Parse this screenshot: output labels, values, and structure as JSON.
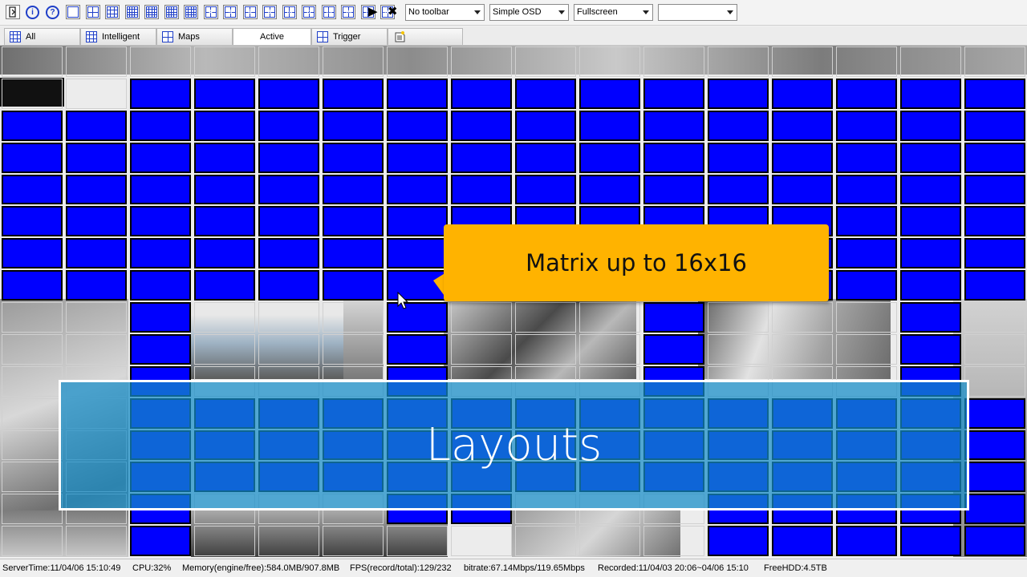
{
  "toolbar": {
    "layout_buttons": [
      "1",
      "4",
      "6",
      "9",
      "10",
      "13",
      "16",
      "4",
      "5",
      "8",
      "8",
      "10",
      "12",
      "13",
      "16",
      "16",
      "3x3"
    ],
    "osd_toolbar": "No toolbar",
    "osd_mode": "Simple OSD",
    "screen_mode": "Fullscreen",
    "extra_select": ""
  },
  "tabs": [
    {
      "label": "All"
    },
    {
      "label": "Intelligent"
    },
    {
      "label": "Maps"
    },
    {
      "label": "Active"
    },
    {
      "label": "Trigger"
    },
    {
      "label": ""
    }
  ],
  "callout": {
    "text": "Matrix up to 16x16"
  },
  "banner": {
    "text": "Layouts"
  },
  "status": {
    "server_time": "ServerTime:11/04/06 15:10:49",
    "cpu": "CPU:32%",
    "memory": "Memory(engine/free):584.0MB/907.8MB",
    "fps": "FPS(record/total):129/232",
    "bitrate": "bitrate:67.14Mbps/119.65Mbps",
    "recorded": "Recorded:11/04/03 20:06~04/06 15:10",
    "free_hdd": "FreeHDD:4.5TB"
  },
  "colors": {
    "empty_channel": "#0000ff",
    "callout": "#ffb300",
    "banner": "#148cc8"
  }
}
